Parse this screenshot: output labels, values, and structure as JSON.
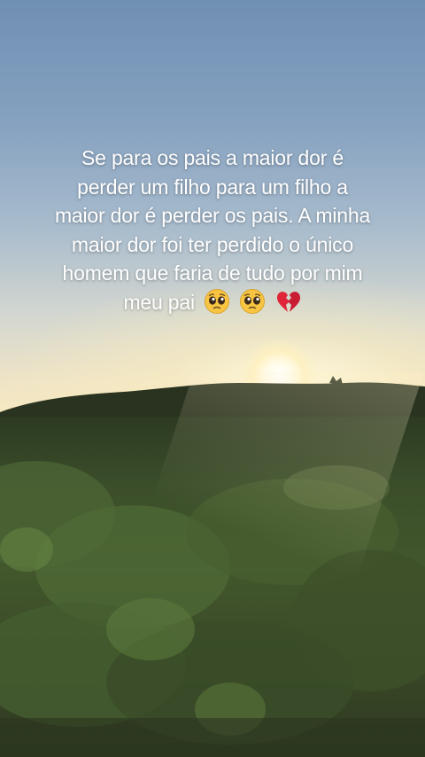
{
  "story": {
    "caption_lines": [
      "Se para os pais a maior dor é",
      "perder um filho para um filho a",
      "maior dor é perder os pais. A minha",
      "maior dor foi ter perdido o único",
      "homem que faria de tudo por mim",
      "meu pai"
    ],
    "emojis": [
      "pleading-face-icon",
      "pleading-face-icon",
      "broken-heart-icon"
    ]
  },
  "colors": {
    "sky_top": "#6f8fb3",
    "sky_horizon": "#f6e9bf",
    "vegetation": "#42572c",
    "text": "#ffffff",
    "broken_heart": "#e0243a",
    "emoji_face": "#f7c542"
  }
}
